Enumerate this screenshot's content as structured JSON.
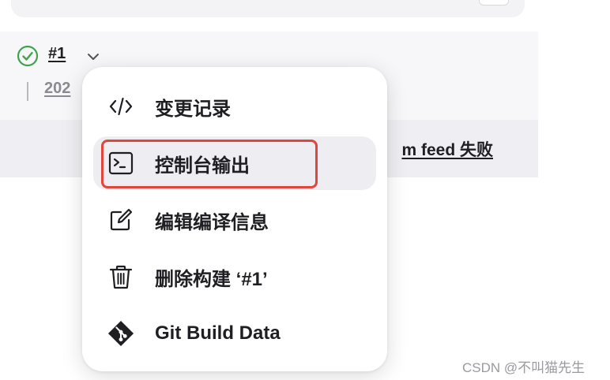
{
  "build": {
    "number": "#1",
    "date_partial": "202",
    "cause_partial": "m feed 失败",
    "status": "success"
  },
  "menu": {
    "items": [
      {
        "label": "变更记录",
        "icon": "code-icon"
      },
      {
        "label": "控制台输出",
        "icon": "terminal-icon",
        "highlighted": true
      },
      {
        "label": "编辑编译信息",
        "icon": "edit-icon"
      },
      {
        "label": "删除构建 ‘#1’",
        "icon": "trash-icon"
      },
      {
        "label": "Git Build Data",
        "icon": "git-icon"
      }
    ]
  },
  "watermark": "CSDN @不叫猫先生",
  "colors": {
    "success": "#3fa34d",
    "annotation": "#e2453b",
    "highlight_bg": "#ededf2"
  }
}
